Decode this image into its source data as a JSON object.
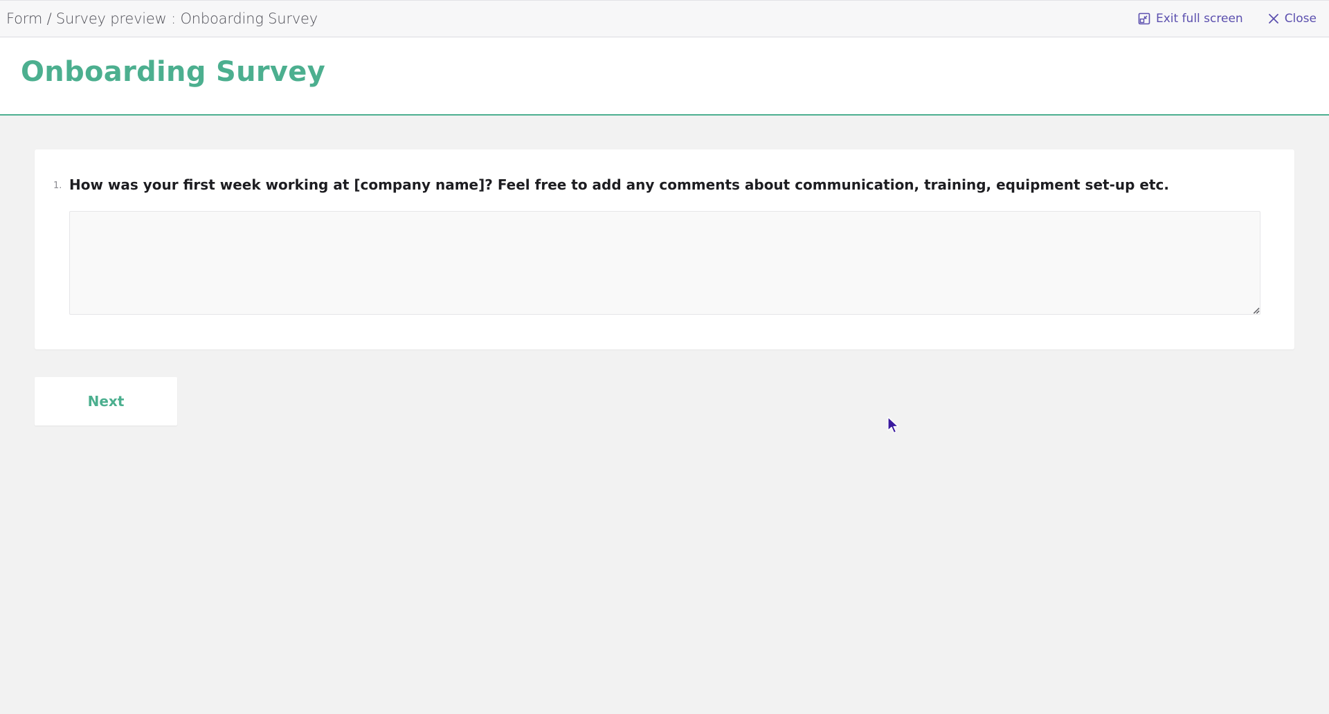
{
  "topbar": {
    "breadcrumb": "Form / Survey preview : Onboarding Survey",
    "exit_fullscreen_label": "Exit full screen",
    "close_label": "Close",
    "accent_color": "#5b4fae"
  },
  "header": {
    "title": "Onboarding Survey",
    "title_color": "#4caf8f"
  },
  "question": {
    "number": "1.",
    "text": "How was your first week working at [company name]? Feel free to add any comments about communication, training, equipment set-up etc.",
    "answer_value": ""
  },
  "footer": {
    "next_label": "Next"
  },
  "icons": {
    "exit_fullscreen": "exit-fullscreen-icon",
    "close": "close-icon",
    "resize": "resize-grip-icon",
    "cursor": "mouse-pointer-icon"
  }
}
